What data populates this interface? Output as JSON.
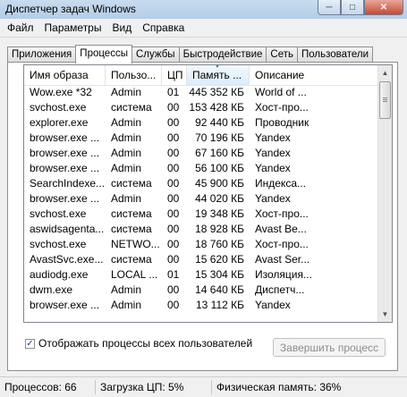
{
  "window": {
    "title": "Диспетчер задач Windows"
  },
  "menu": [
    "Файл",
    "Параметры",
    "Вид",
    "Справка"
  ],
  "tabs": [
    "Приложения",
    "Процессы",
    "Службы",
    "Быстродействие",
    "Сеть",
    "Пользователи"
  ],
  "active_tab": "Процессы",
  "columns": [
    "Имя образа",
    "Пользо...",
    "ЦП",
    "Память ...",
    "Описание"
  ],
  "sorted_column": "Память ...",
  "rows": [
    [
      "Wow.exe *32",
      "Admin",
      "01",
      "445 352 КБ",
      "World of ..."
    ],
    [
      "svchost.exe",
      "система",
      "00",
      "153 428 КБ",
      "Хост-про..."
    ],
    [
      "explorer.exe",
      "Admin",
      "00",
      "92 440 КБ",
      "Проводник"
    ],
    [
      "browser.exe ...",
      "Admin",
      "00",
      "70 196 КБ",
      "Yandex"
    ],
    [
      "browser.exe ...",
      "Admin",
      "00",
      "67 160 КБ",
      "Yandex"
    ],
    [
      "browser.exe ...",
      "Admin",
      "00",
      "56 100 КБ",
      "Yandex"
    ],
    [
      "SearchIndexe...",
      "система",
      "00",
      "45 900 КБ",
      "Индекса..."
    ],
    [
      "browser.exe ...",
      "Admin",
      "00",
      "44 020 КБ",
      "Yandex"
    ],
    [
      "svchost.exe",
      "система",
      "00",
      "19 348 КБ",
      "Хост-про..."
    ],
    [
      "aswidsagenta...",
      "система",
      "00",
      "18 928 КБ",
      "Avast Be..."
    ],
    [
      "svchost.exe",
      "NETWO...",
      "00",
      "18 760 КБ",
      "Хост-про..."
    ],
    [
      "AvastSvc.exe...",
      "система",
      "00",
      "15 620 КБ",
      "Avast Ser..."
    ],
    [
      "audiodg.exe",
      "LOCAL ...",
      "01",
      "15 304 КБ",
      "Изоляция..."
    ],
    [
      "dwm.exe",
      "Admin",
      "00",
      "14 640 КБ",
      "Диспетч..."
    ],
    [
      "browser.exe ...",
      "Admin",
      "00",
      "13 112 КБ",
      "Yandex"
    ]
  ],
  "show_all_label": "Отображать процессы всех пользователей",
  "show_all_checked": true,
  "end_process_label": "Завершить процесс",
  "status": {
    "processes": "Процессов: 66",
    "cpu": "Загрузка ЦП: 5%",
    "memory": "Физическая память: 36%"
  },
  "icons": {
    "minimize": "minimize-icon",
    "maximize": "maximize-icon",
    "close": "close-icon",
    "sort": "sort-desc-icon"
  }
}
